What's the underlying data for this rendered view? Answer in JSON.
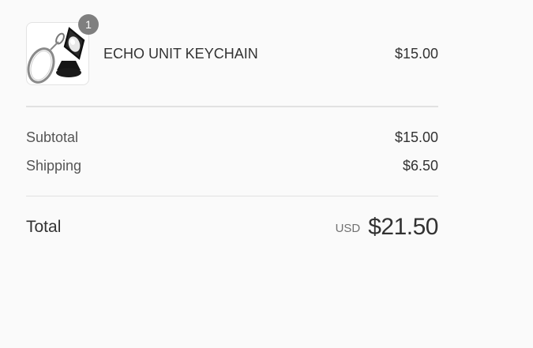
{
  "cart": {
    "items": [
      {
        "quantity": "1",
        "name": "ECHO UNIT KEYCHAIN",
        "price": "$15.00",
        "image_icon": "keychain-product-image"
      }
    ]
  },
  "summary": {
    "subtotal_label": "Subtotal",
    "subtotal_value": "$15.00",
    "shipping_label": "Shipping",
    "shipping_value": "$6.50",
    "total_label": "Total",
    "currency": "USD",
    "total_value": "$21.50"
  },
  "colors": {
    "background": "#fafafa",
    "badge": "#7f7f7f",
    "divider": "#e1e1e1",
    "text": "#323232"
  }
}
